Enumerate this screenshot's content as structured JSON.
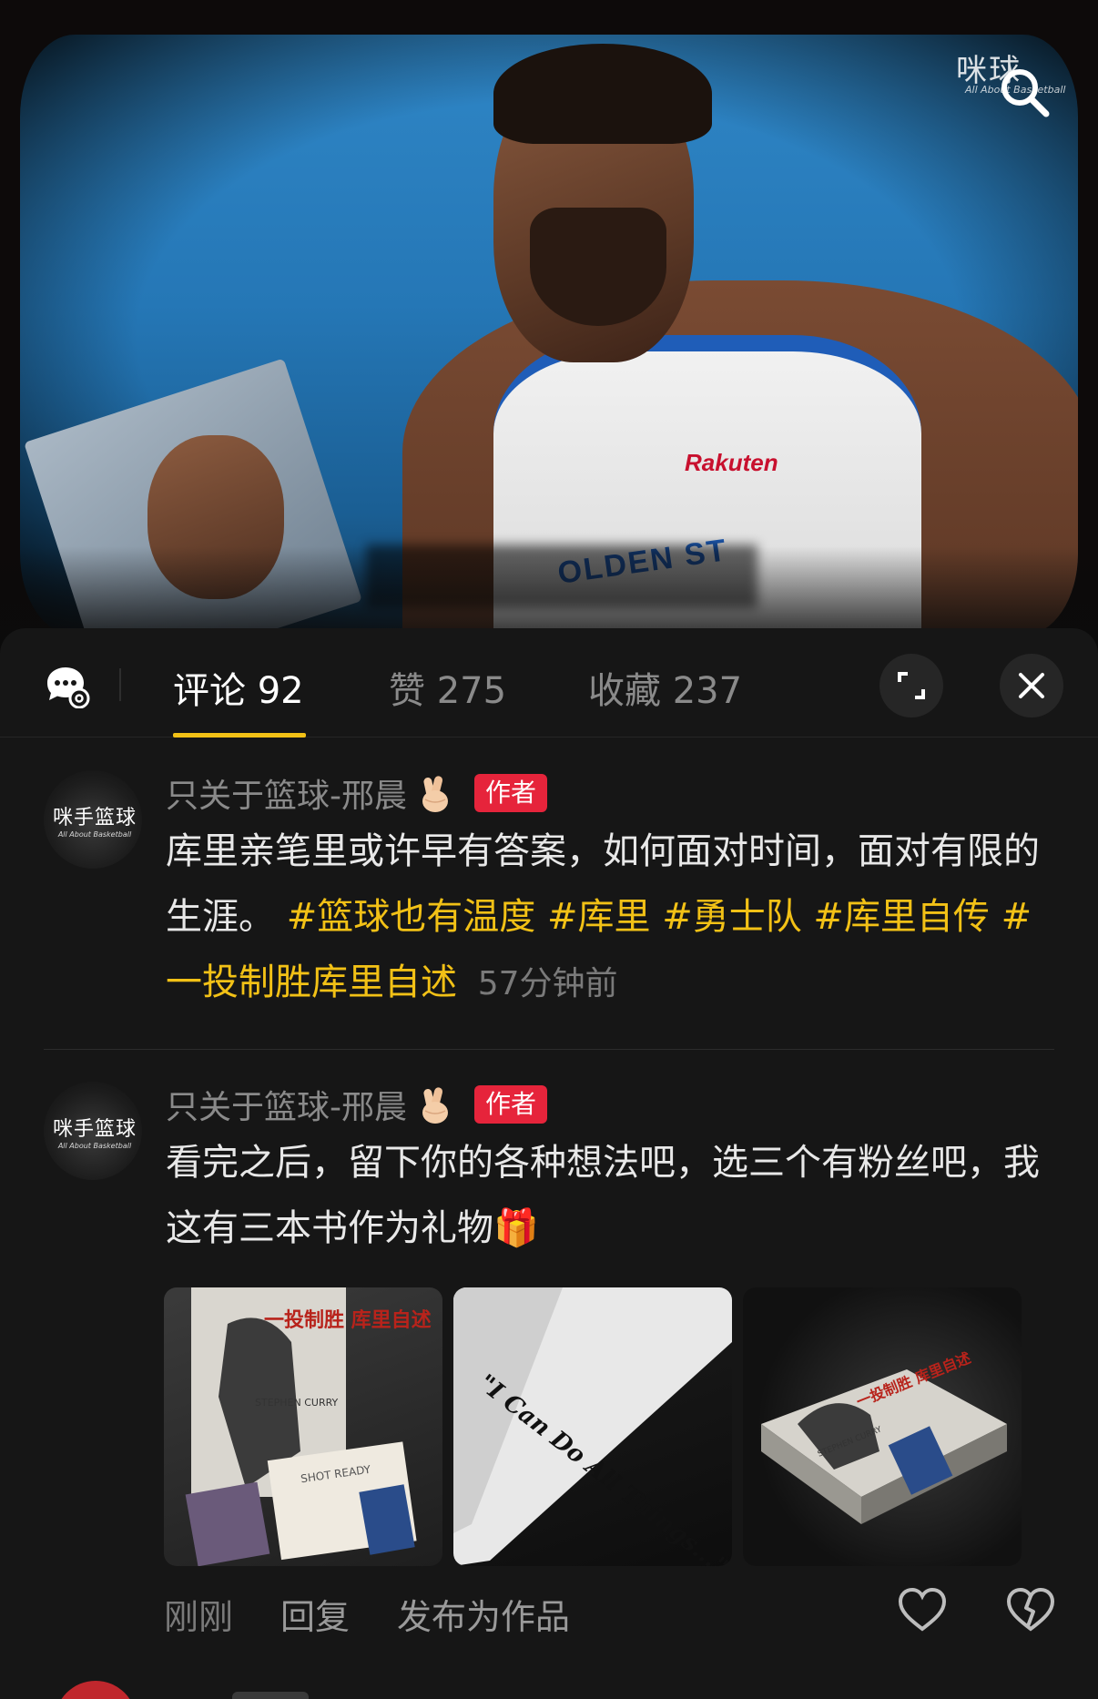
{
  "video": {
    "watermark": "咪球",
    "watermark_sub": "All About Basketball",
    "jersey_brand": "Rakuten",
    "jersey_team": "OLDEN ST",
    "search_icon": "search-icon"
  },
  "tabs": {
    "comments_label": "评论 92",
    "likes_label": "赞 275",
    "favorites_label": "收藏 237",
    "active_color": "#f2c116",
    "icons": [
      "chat-bubble-icon",
      "expand-icon",
      "close-icon"
    ]
  },
  "comments": [
    {
      "username": "只关于篮球-邢晨",
      "badge": "作者",
      "avatar_text": "咪手篮球",
      "avatar_sub": "All About Basketball",
      "text": "库里亲笔里或许早有答案，如何面对时间，面对有限的生涯。",
      "hashtags": [
        "#篮球也有温度",
        "#库里",
        "#勇士队",
        "#库里自传",
        "#一投制胜库里自述"
      ],
      "time": "57分钟前"
    },
    {
      "username": "只关于篮球-邢晨",
      "badge": "作者",
      "avatar_text": "咪手篮球",
      "avatar_sub": "All About Basketball",
      "text": "看完之后，留下你的各种想法吧，选三个有粉丝吧，我这有三本书作为礼物🎁",
      "images": [
        {
          "title": "一投制胜 库里自述",
          "caption": "STEPHEN CURRY",
          "card": "SHOT READY"
        },
        {
          "text": "\"I Can Do All Things...\""
        },
        {
          "title": "一投制胜 库里自述",
          "caption": "STEPHEN CURRY"
        }
      ],
      "time": "刚刚",
      "reply_label": "回复",
      "publish_label": "发布为作品"
    }
  ],
  "colors": {
    "badge": "#e6243b",
    "hashtag": "#f2c116",
    "sheet_bg": "#161616"
  }
}
